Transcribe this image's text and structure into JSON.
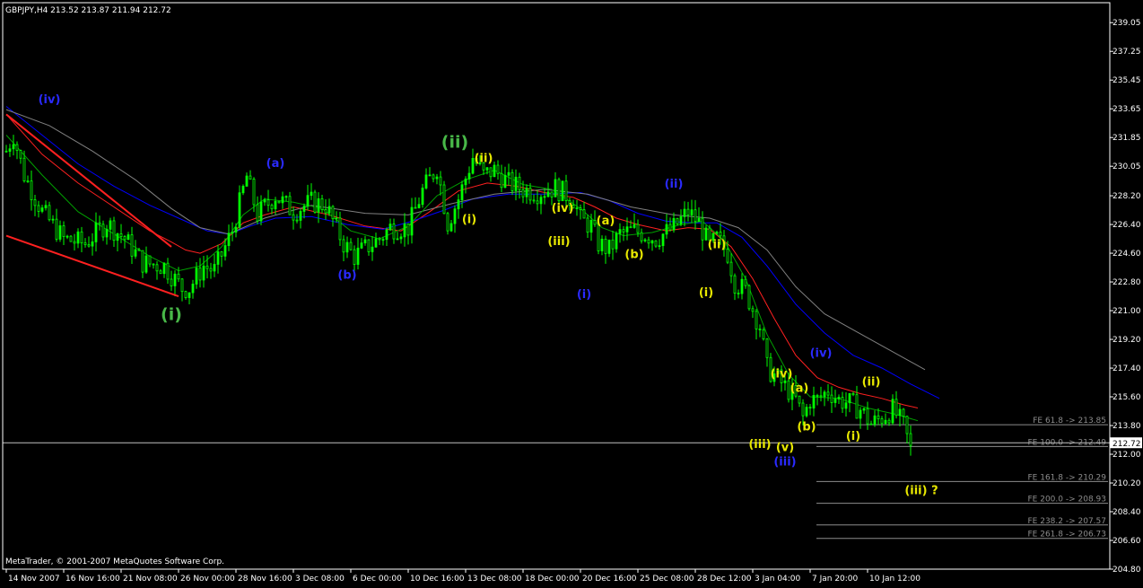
{
  "chart_data": {
    "type": "candlestick",
    "title": "GBPJPY,H4  213.52 213.87 211.94 212.72",
    "symbol": "GBPJPY",
    "timeframe": "H4",
    "ohlc_header": {
      "open": 213.52,
      "high": 213.87,
      "low": 211.94,
      "close": 212.72
    },
    "last_price": 212.72,
    "copyright": "MetaTrader, © 2001-2007 MetaQuotes Software Corp.",
    "ylim": [
      204.8,
      240.3
    ],
    "y_ticks": [
      239.05,
      237.25,
      235.45,
      233.65,
      231.85,
      230.05,
      228.2,
      226.4,
      224.6,
      222.8,
      221.0,
      219.2,
      217.4,
      215.6,
      213.8,
      212.0,
      210.2,
      208.4,
      206.6,
      204.8
    ],
    "x_ticks": [
      "14 Nov 2007",
      "16 Nov 16:00",
      "21 Nov 08:00",
      "26 Nov 00:00",
      "28 Nov 16:00",
      "3 Dec 08:00",
      "6 Dec 00:00",
      "10 Dec 16:00",
      "13 Dec 08:00",
      "18 Dec 00:00",
      "20 Dec 16:00",
      "25 Dec 08:00",
      "28 Dec 12:00",
      "3 Jan 04:00",
      "7 Jan 20:00",
      "10 Jan 12:00"
    ],
    "price_path": [
      [
        0,
        231.0
      ],
      [
        2,
        232.0
      ],
      [
        5,
        229.5
      ],
      [
        10,
        227.2
      ],
      [
        16,
        225.5
      ],
      [
        22,
        225.2
      ],
      [
        28,
        226.5
      ],
      [
        33,
        225.5
      ],
      [
        38,
        224.0
      ],
      [
        44,
        223.8
      ],
      [
        49,
        222.4
      ],
      [
        51,
        222.4
      ],
      [
        55,
        223.8
      ],
      [
        58,
        223.5
      ],
      [
        63,
        226.0
      ],
      [
        67,
        229.4
      ],
      [
        70,
        227.0
      ],
      [
        75,
        228.2
      ],
      [
        80,
        227.2
      ],
      [
        85,
        227.8
      ],
      [
        89,
        227.6
      ],
      [
        94,
        225.2
      ],
      [
        97,
        224.4
      ],
      [
        100,
        224.9
      ],
      [
        104,
        225.5
      ],
      [
        107,
        226.2
      ],
      [
        112,
        226.2
      ],
      [
        116,
        228.5
      ],
      [
        120,
        230.0
      ],
      [
        123,
        226.5
      ],
      [
        126,
        228.0
      ],
      [
        130,
        230.6
      ],
      [
        133,
        229.5
      ],
      [
        136,
        229.8
      ],
      [
        140,
        229.0
      ],
      [
        144,
        228.6
      ],
      [
        148,
        228.4
      ],
      [
        153,
        228.7
      ],
      [
        158,
        228.0
      ],
      [
        160,
        226.7
      ],
      [
        163,
        226.3
      ],
      [
        165,
        225.2
      ],
      [
        168,
        224.8
      ],
      [
        171,
        225.8
      ],
      [
        175,
        226.0
      ],
      [
        178,
        225.8
      ],
      [
        181,
        225.5
      ],
      [
        186,
        226.2
      ],
      [
        190,
        227.2
      ],
      [
        193,
        226.5
      ],
      [
        196,
        225.0
      ],
      [
        198,
        225.5
      ],
      [
        201,
        224.6
      ],
      [
        203,
        222.8
      ],
      [
        206,
        222.2
      ],
      [
        210,
        220.0
      ],
      [
        212,
        217.4
      ],
      [
        215,
        216.7
      ],
      [
        218,
        216.0
      ],
      [
        220,
        215.4
      ],
      [
        222,
        214.3
      ],
      [
        224,
        215.4
      ],
      [
        226,
        215.4
      ],
      [
        229,
        216.0
      ],
      [
        232,
        215.4
      ],
      [
        235,
        215.2
      ],
      [
        238,
        214.8
      ],
      [
        241,
        213.9
      ],
      [
        244,
        214.3
      ],
      [
        247,
        214.8
      ],
      [
        250,
        213.8
      ],
      [
        252,
        212.3
      ]
    ],
    "series": [
      {
        "name": "",
        "color": "#ff2020",
        "values": [
          [
            0,
            233.3
          ],
          [
            10,
            230.8
          ],
          [
            20,
            229.0
          ],
          [
            30,
            227.5
          ],
          [
            40,
            226.0
          ],
          [
            46,
            225.3
          ],
          [
            50,
            224.8
          ],
          [
            54,
            224.6
          ],
          [
            60,
            225.2
          ],
          [
            66,
            226.5
          ],
          [
            72,
            227.0
          ],
          [
            80,
            227.5
          ],
          [
            90,
            227.0
          ],
          [
            100,
            226.3
          ],
          [
            110,
            226.0
          ],
          [
            118,
            227.2
          ],
          [
            126,
            228.5
          ],
          [
            134,
            229.0
          ],
          [
            142,
            228.8
          ],
          [
            150,
            228.4
          ],
          [
            158,
            228.1
          ],
          [
            164,
            227.5
          ],
          [
            170,
            226.8
          ],
          [
            176,
            226.4
          ],
          [
            184,
            226.0
          ],
          [
            190,
            226.2
          ],
          [
            196,
            226.1
          ],
          [
            202,
            225.0
          ],
          [
            208,
            223.0
          ],
          [
            214,
            220.5
          ],
          [
            220,
            218.2
          ],
          [
            226,
            216.8
          ],
          [
            232,
            216.2
          ],
          [
            238,
            215.8
          ],
          [
            244,
            215.5
          ],
          [
            250,
            215.1
          ],
          [
            254,
            214.9
          ]
        ]
      },
      {
        "name": "",
        "color": "#0000ff",
        "values": [
          [
            0,
            233.8
          ],
          [
            10,
            232.0
          ],
          [
            20,
            230.2
          ],
          [
            30,
            228.8
          ],
          [
            40,
            227.6
          ],
          [
            50,
            226.6
          ],
          [
            56,
            226.0
          ],
          [
            62,
            225.8
          ],
          [
            68,
            226.3
          ],
          [
            75,
            226.8
          ],
          [
            85,
            226.9
          ],
          [
            95,
            226.4
          ],
          [
            105,
            226.1
          ],
          [
            113,
            226.6
          ],
          [
            122,
            227.3
          ],
          [
            130,
            228.0
          ],
          [
            140,
            228.3
          ],
          [
            150,
            228.3
          ],
          [
            160,
            228.4
          ],
          [
            168,
            227.9
          ],
          [
            176,
            227.1
          ],
          [
            184,
            226.6
          ],
          [
            192,
            226.5
          ],
          [
            198,
            226.5
          ],
          [
            205,
            225.6
          ],
          [
            212,
            223.8
          ],
          [
            220,
            221.4
          ],
          [
            228,
            219.6
          ],
          [
            236,
            218.2
          ],
          [
            244,
            217.4
          ],
          [
            252,
            216.4
          ],
          [
            260,
            215.5
          ]
        ]
      },
      {
        "name": "",
        "color": "#808080",
        "values": [
          [
            0,
            233.6
          ],
          [
            12,
            232.6
          ],
          [
            24,
            231.0
          ],
          [
            36,
            229.2
          ],
          [
            46,
            227.4
          ],
          [
            54,
            226.2
          ],
          [
            62,
            225.8
          ],
          [
            72,
            226.8
          ],
          [
            85,
            227.6
          ],
          [
            100,
            227.1
          ],
          [
            112,
            227.0
          ],
          [
            124,
            227.7
          ],
          [
            136,
            228.3
          ],
          [
            150,
            228.6
          ],
          [
            162,
            228.3
          ],
          [
            174,
            227.5
          ],
          [
            186,
            227.0
          ],
          [
            196,
            226.8
          ],
          [
            204,
            226.2
          ],
          [
            212,
            224.8
          ],
          [
            220,
            222.5
          ],
          [
            228,
            220.8
          ],
          [
            236,
            219.8
          ],
          [
            244,
            218.8
          ],
          [
            252,
            217.8
          ],
          [
            256,
            217.3
          ]
        ]
      },
      {
        "name": "",
        "color": "#00a000",
        "values": [
          [
            0,
            232.0
          ],
          [
            10,
            229.5
          ],
          [
            20,
            227.2
          ],
          [
            30,
            225.8
          ],
          [
            40,
            224.4
          ],
          [
            48,
            223.5
          ],
          [
            54,
            223.8
          ],
          [
            60,
            225.0
          ],
          [
            66,
            227.0
          ],
          [
            72,
            228.0
          ],
          [
            80,
            227.8
          ],
          [
            88,
            227.4
          ],
          [
            96,
            226.0
          ],
          [
            104,
            225.5
          ],
          [
            112,
            226.3
          ],
          [
            120,
            228.2
          ],
          [
            128,
            229.2
          ],
          [
            136,
            229.8
          ],
          [
            144,
            228.9
          ],
          [
            152,
            228.6
          ],
          [
            160,
            227.4
          ],
          [
            166,
            226.2
          ],
          [
            172,
            225.7
          ],
          [
            180,
            225.9
          ],
          [
            188,
            226.4
          ],
          [
            194,
            226.6
          ],
          [
            200,
            225.4
          ],
          [
            206,
            223.0
          ],
          [
            212,
            219.5
          ],
          [
            218,
            217.0
          ],
          [
            224,
            215.6
          ],
          [
            232,
            215.5
          ],
          [
            240,
            214.9
          ],
          [
            248,
            214.5
          ],
          [
            254,
            214.1
          ]
        ]
      }
    ],
    "trendlines": [
      {
        "color": "#ff2020",
        "from": [
          0,
          233.3
        ],
        "to": [
          46,
          225.0
        ]
      },
      {
        "color": "#ff2020",
        "from": [
          0,
          225.7
        ],
        "to": [
          48,
          221.9
        ]
      }
    ],
    "fibonacci_levels": [
      {
        "label": "FE 61.8 -> 213.85",
        "value": 213.85
      },
      {
        "label": "FE 100.0 -> 212.49",
        "value": 212.49
      },
      {
        "label": "FE 161.8 -> 210.29",
        "value": 210.29
      },
      {
        "label": "FE 200.0 -> 208.93",
        "value": 208.93
      },
      {
        "label": "FE 238.2 -> 207.57",
        "value": 207.57
      },
      {
        "label": "FE 261.8 -> 206.73",
        "value": 206.73
      }
    ],
    "wave_labels": [
      {
        "text": "(iv)",
        "color": "#2a2aff",
        "bar": 12,
        "price": 234.0,
        "size": "normal"
      },
      {
        "text": "(i)",
        "color": "#48b848",
        "bar": 46,
        "price": 220.4,
        "size": "big"
      },
      {
        "text": "(a)",
        "color": "#2a2aff",
        "bar": 75,
        "price": 230.0,
        "size": "normal"
      },
      {
        "text": "(b)",
        "color": "#2a2aff",
        "bar": 95,
        "price": 223.0,
        "size": "normal"
      },
      {
        "text": "(ii)",
        "color": "#48b848",
        "bar": 125,
        "price": 231.2,
        "size": "big"
      },
      {
        "text": "(ii)",
        "color": "#e8e800",
        "bar": 133,
        "price": 230.3,
        "size": "normal"
      },
      {
        "text": "(i)",
        "color": "#e8e800",
        "bar": 129,
        "price": 226.5,
        "size": "normal"
      },
      {
        "text": "(iv)",
        "color": "#e8e800",
        "bar": 155,
        "price": 227.2,
        "size": "normal"
      },
      {
        "text": "(iii)",
        "color": "#e8e800",
        "bar": 154,
        "price": 225.1,
        "size": "normal"
      },
      {
        "text": "(a)",
        "color": "#e8e800",
        "bar": 167,
        "price": 226.4,
        "size": "normal"
      },
      {
        "text": "(b)",
        "color": "#e8e800",
        "bar": 175,
        "price": 224.3,
        "size": "normal"
      },
      {
        "text": "(i)",
        "color": "#2a2aff",
        "bar": 161,
        "price": 221.8,
        "size": "normal"
      },
      {
        "text": "(ii)",
        "color": "#2a2aff",
        "bar": 186,
        "price": 228.7,
        "size": "normal"
      },
      {
        "text": "(ii)",
        "color": "#e8e800",
        "bar": 198,
        "price": 224.9,
        "size": "normal"
      },
      {
        "text": "(i)",
        "color": "#e8e800",
        "bar": 195,
        "price": 221.9,
        "size": "normal"
      },
      {
        "text": "(iv)",
        "color": "#e8e800",
        "bar": 216,
        "price": 216.8,
        "size": "normal"
      },
      {
        "text": "(a)",
        "color": "#e8e800",
        "bar": 221,
        "price": 215.9,
        "size": "normal"
      },
      {
        "text": "(b)",
        "color": "#e8e800",
        "bar": 223,
        "price": 213.5,
        "size": "normal"
      },
      {
        "text": "(iii)",
        "color": "#e8e800",
        "bar": 210,
        "price": 212.4,
        "size": "normal"
      },
      {
        "text": "(v)",
        "color": "#e8e800",
        "bar": 217,
        "price": 212.2,
        "size": "normal"
      },
      {
        "text": "(iii)",
        "color": "#2a2aff",
        "bar": 217,
        "price": 211.3,
        "size": "normal"
      },
      {
        "text": "(iv)",
        "color": "#2a2aff",
        "bar": 227,
        "price": 218.1,
        "size": "normal"
      },
      {
        "text": "(ii)",
        "color": "#e8e800",
        "bar": 241,
        "price": 216.3,
        "size": "normal"
      },
      {
        "text": "(i)",
        "color": "#e8e800",
        "bar": 236,
        "price": 212.9,
        "size": "normal"
      },
      {
        "text": "(iii) ?",
        "color": "#e8e800",
        "bar": 255,
        "price": 209.5,
        "size": "normal"
      }
    ],
    "colors": {
      "background": "#000000",
      "axis": "#ffffff",
      "bull": "#00ff00",
      "bear": "#00ff00",
      "fib": "#8c8c8c"
    }
  }
}
